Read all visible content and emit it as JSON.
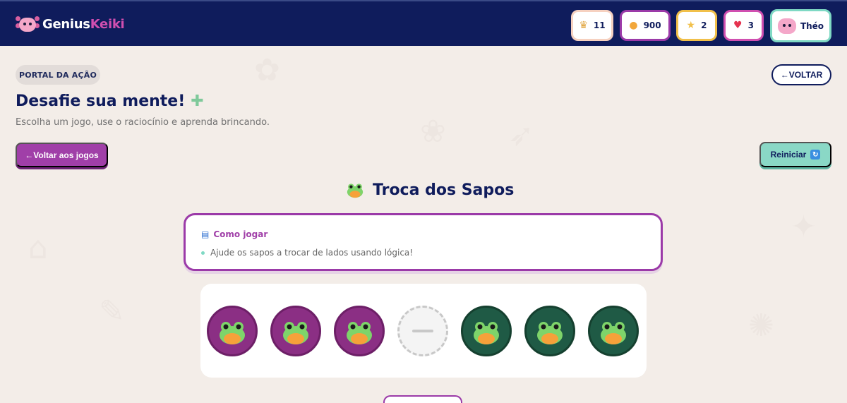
{
  "app": {
    "logo_part1": "Genius",
    "logo_part2": "Keiki"
  },
  "stats": {
    "trophy": {
      "icon": "trophy-icon",
      "value": "11"
    },
    "coins": {
      "icon": "coin-icon",
      "value": "900"
    },
    "stars": {
      "icon": "star-icon",
      "value": "2"
    },
    "hearts": {
      "icon": "heart-icon",
      "value": "3"
    },
    "user": {
      "icon": "axolotl-avatar-icon",
      "name": "Théo"
    }
  },
  "header": {
    "portal_label": "PORTAL DA AÇÃO",
    "back_label": "←VOLTAR",
    "title": "Desafie sua mente!",
    "subtitle": "Escolha um jogo, use o raciocínio e aprenda brincando."
  },
  "actions": {
    "back_games_label": "←Voltar aos jogos",
    "restart_label": "Reiniciar"
  },
  "game": {
    "title": "Troca dos Sapos",
    "howto_title": "Como jogar",
    "howto_items": [
      "Ajude os sapos a trocar de lados usando lógica!"
    ],
    "pads": [
      {
        "state": "purple-frog"
      },
      {
        "state": "purple-frog"
      },
      {
        "state": "purple-frog"
      },
      {
        "state": "empty"
      },
      {
        "state": "green-frog"
      },
      {
        "state": "green-frog"
      },
      {
        "state": "green-frog"
      }
    ]
  },
  "colors": {
    "navy": "#0f1c5c",
    "purple": "#9b3aa8",
    "mint": "#8ad8c6",
    "pad_purple": "#8b2f84",
    "pad_green": "#1f5a45"
  }
}
